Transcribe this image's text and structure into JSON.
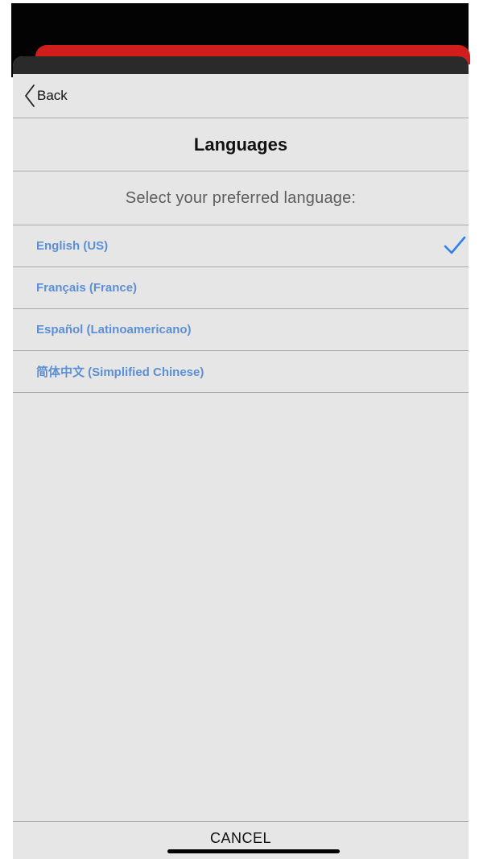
{
  "nav": {
    "back_label": "Back"
  },
  "page": {
    "title": "Languages",
    "prompt": "Select your preferred language:"
  },
  "languages": [
    {
      "label": "English (US)",
      "selected": true
    },
    {
      "label": "Français (France)",
      "selected": false
    },
    {
      "label": "Español (Latinoamericano)",
      "selected": false
    },
    {
      "label": "简体中文 (Simplified Chinese)",
      "selected": false
    }
  ],
  "footer": {
    "cancel_label": "CANCEL"
  },
  "icons": {
    "back": "chevron-left-icon",
    "selected": "checkmark-icon"
  },
  "colors": {
    "accent": "#2f80ed",
    "language_text": "#5b8fd6",
    "brand_red": "#d21d1d",
    "sheet_background": "#e6e6e6"
  }
}
